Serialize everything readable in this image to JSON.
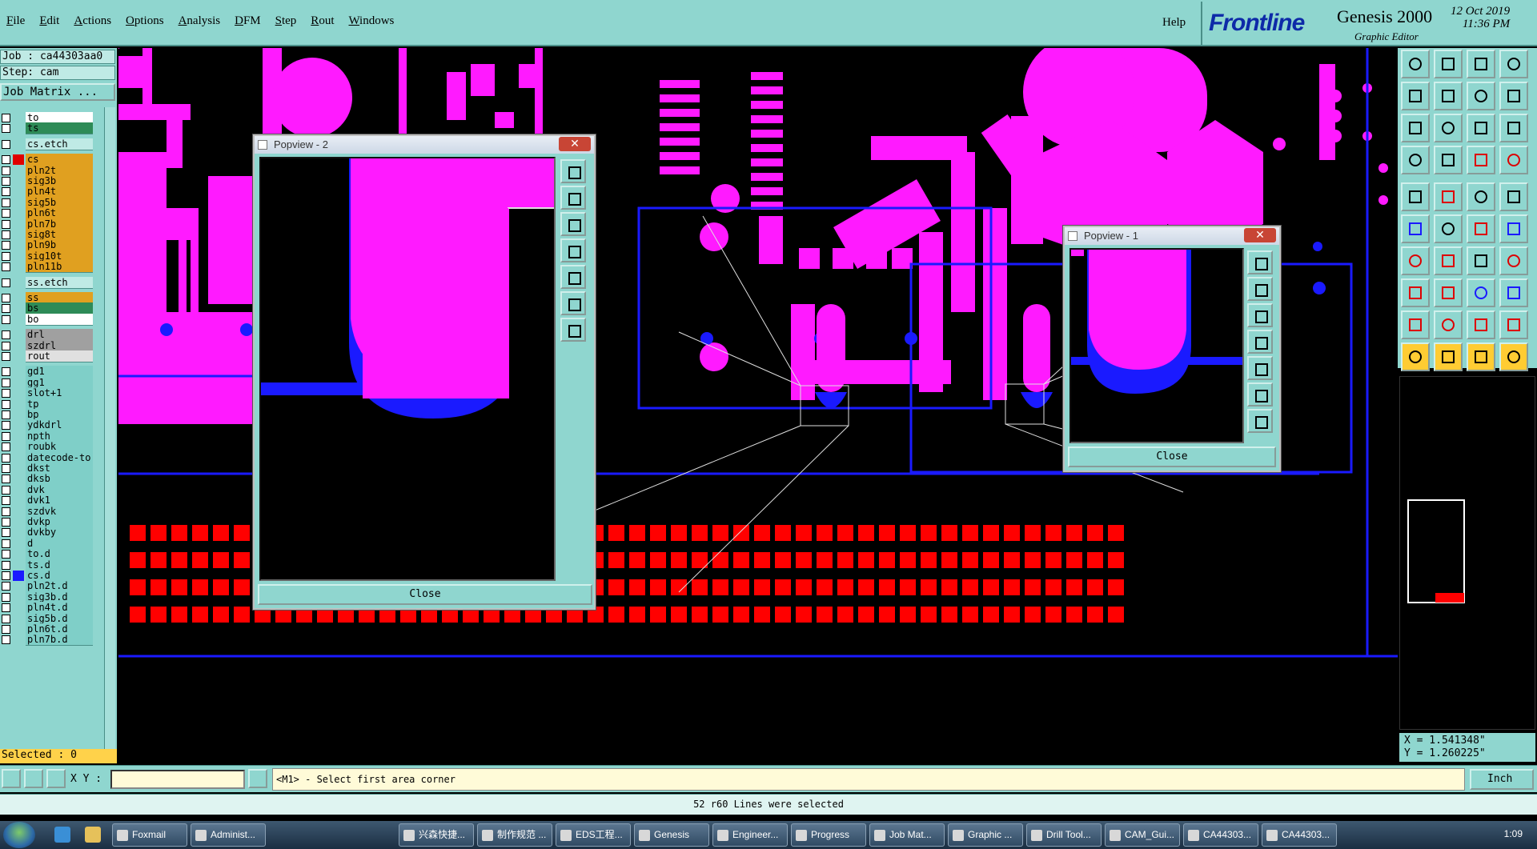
{
  "menu": [
    "File",
    "Edit",
    "Actions",
    "Options",
    "Analysis",
    "DFM",
    "Step",
    "Rout",
    "Windows"
  ],
  "help": "Help",
  "brand": {
    "logo": "Frontline",
    "product": "Genesis 2000",
    "subtitle": "Graphic Editor",
    "date": "12 Oct 2019",
    "time": "11:36 PM"
  },
  "job": "Job : ca44303aa0",
  "step": "Step: cam",
  "job_matrix": "Job Matrix ...",
  "layers": [
    {
      "name": "to",
      "color": "#ffffff",
      "sw": ""
    },
    {
      "name": "ts",
      "color": "#2e8b57",
      "sw": ""
    },
    {
      "name": "cs.etch",
      "color": "#bfeae5",
      "sw": ""
    },
    {
      "name": "cs",
      "color": "#e0a020",
      "sw": "#e00000"
    },
    {
      "name": "pln2t",
      "color": "#e0a020",
      "sw": ""
    },
    {
      "name": "sig3b",
      "color": "#e0a020",
      "sw": ""
    },
    {
      "name": "pln4t",
      "color": "#e0a020",
      "sw": ""
    },
    {
      "name": "sig5b",
      "color": "#e0a020",
      "sw": ""
    },
    {
      "name": "pln6t",
      "color": "#e0a020",
      "sw": ""
    },
    {
      "name": "pln7b",
      "color": "#e0a020",
      "sw": ""
    },
    {
      "name": "sig8t",
      "color": "#e0a020",
      "sw": ""
    },
    {
      "name": "pln9b",
      "color": "#e0a020",
      "sw": ""
    },
    {
      "name": "sig10t",
      "color": "#e0a020",
      "sw": ""
    },
    {
      "name": "pln11b",
      "color": "#e0a020",
      "sw": ""
    },
    {
      "name": "ss.etch",
      "color": "#bfeae5",
      "sw": ""
    },
    {
      "name": "ss",
      "color": "#e0a020",
      "sw": ""
    },
    {
      "name": "bs",
      "color": "#2e8b57",
      "sw": ""
    },
    {
      "name": "bo",
      "color": "#ffffff",
      "sw": ""
    },
    {
      "name": "drl",
      "color": "#a0a0a0",
      "sw": ""
    },
    {
      "name": "szdrl",
      "color": "#a0a0a0",
      "sw": ""
    },
    {
      "name": "rout",
      "color": "#e0e0e0",
      "sw": ""
    },
    {
      "name": "gd1",
      "color": "#7fcfc8",
      "sw": ""
    },
    {
      "name": "gg1",
      "color": "#7fcfc8",
      "sw": ""
    },
    {
      "name": "slot+1",
      "color": "#7fcfc8",
      "sw": ""
    },
    {
      "name": "tp",
      "color": "#7fcfc8",
      "sw": ""
    },
    {
      "name": "bp",
      "color": "#7fcfc8",
      "sw": ""
    },
    {
      "name": "ydkdrl",
      "color": "#7fcfc8",
      "sw": ""
    },
    {
      "name": "npth",
      "color": "#7fcfc8",
      "sw": ""
    },
    {
      "name": "roubk",
      "color": "#7fcfc8",
      "sw": ""
    },
    {
      "name": "datecode-to",
      "color": "#7fcfc8",
      "sw": ""
    },
    {
      "name": "dkst",
      "color": "#7fcfc8",
      "sw": ""
    },
    {
      "name": "dksb",
      "color": "#7fcfc8",
      "sw": ""
    },
    {
      "name": "dvk",
      "color": "#7fcfc8",
      "sw": ""
    },
    {
      "name": "dvk1",
      "color": "#7fcfc8",
      "sw": ""
    },
    {
      "name": "szdvk",
      "color": "#7fcfc8",
      "sw": ""
    },
    {
      "name": "dvkp",
      "color": "#7fcfc8",
      "sw": ""
    },
    {
      "name": "dvkby",
      "color": "#7fcfc8",
      "sw": ""
    },
    {
      "name": "d",
      "color": "#7fcfc8",
      "sw": ""
    },
    {
      "name": "to.d",
      "color": "#7fcfc8",
      "sw": ""
    },
    {
      "name": "ts.d",
      "color": "#7fcfc8",
      "sw": ""
    },
    {
      "name": "cs.d",
      "color": "#7fcfc8",
      "sw": "#1a1aff"
    },
    {
      "name": "pln2t.d",
      "color": "#7fcfc8",
      "sw": ""
    },
    {
      "name": "sig3b.d",
      "color": "#7fcfc8",
      "sw": ""
    },
    {
      "name": "pln4t.d",
      "color": "#7fcfc8",
      "sw": ""
    },
    {
      "name": "sig5b.d",
      "color": "#7fcfc8",
      "sw": ""
    },
    {
      "name": "pln6t.d",
      "color": "#7fcfc8",
      "sw": ""
    },
    {
      "name": "pln7b.d",
      "color": "#7fcfc8",
      "sw": ""
    }
  ],
  "selected": "Selected : 0",
  "popup2": {
    "title": "Popview - 2",
    "close": "Close"
  },
  "popup1": {
    "title": "Popview - 1",
    "close": "Close"
  },
  "coords": {
    "x": "X = 1.541348\"",
    "y": "Y = 1.260225\""
  },
  "xy_label": "X Y :",
  "prompt": "<M1> - Select first area corner",
  "unit": "Inch",
  "status": "52 r60 Lines were selected",
  "tasks": [
    "Foxmail",
    "Administ...",
    "兴森快捷...",
    "制作规范 ...",
    "EDS工程...",
    "Genesis",
    "Engineer...",
    "Progress",
    "Job Mat...",
    "Graphic ...",
    "Drill Tool...",
    "CAM_Gui...",
    "CA44303...",
    "CA44303..."
  ],
  "clock": "1:09",
  "colors": {
    "panel": "#8fd6cf",
    "copper": "#ff1aff",
    "pad": "#ff0000",
    "outline": "#1a1aff"
  }
}
